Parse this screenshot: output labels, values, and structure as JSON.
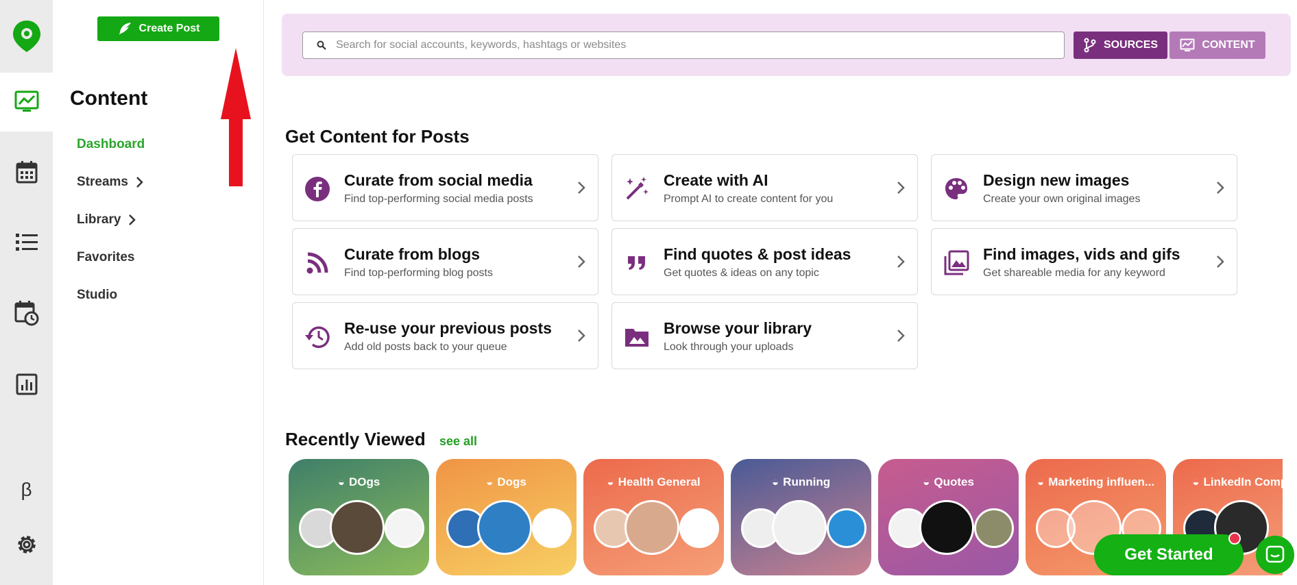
{
  "nav": {
    "create_post": "Create Post",
    "title": "Content",
    "items": [
      {
        "label": "Dashboard",
        "active": true,
        "chevron": false
      },
      {
        "label": "Streams",
        "active": false,
        "chevron": true
      },
      {
        "label": "Library",
        "active": false,
        "chevron": true
      },
      {
        "label": "Favorites",
        "active": false,
        "chevron": false
      },
      {
        "label": "Studio",
        "active": false,
        "chevron": false
      }
    ],
    "beta_label": "β"
  },
  "search": {
    "placeholder": "Search for social accounts, keywords, hashtags or websites",
    "sources_label": "SOURCES",
    "content_label": "CONTENT"
  },
  "sections": {
    "get_content": "Get Content for Posts",
    "recently_viewed": "Recently Viewed",
    "see_all": "see all"
  },
  "cards": [
    {
      "title": "Curate from social media",
      "subtitle": "Find top-performing social media posts",
      "icon": "facebook-icon"
    },
    {
      "title": "Create with AI",
      "subtitle": "Prompt AI to create content for you",
      "icon": "magic-wand-icon"
    },
    {
      "title": "Design new images",
      "subtitle": "Create your own original images",
      "icon": "palette-icon"
    },
    {
      "title": "Curate from blogs",
      "subtitle": "Find top-performing blog posts",
      "icon": "rss-icon"
    },
    {
      "title": "Find quotes & post ideas",
      "subtitle": "Get quotes & ideas on any topic",
      "icon": "quote-icon"
    },
    {
      "title": "Find images, vids and gifs",
      "subtitle": "Get shareable media for any keyword",
      "icon": "images-icon"
    },
    {
      "title": "Re-use your previous posts",
      "subtitle": "Add old posts back to your queue",
      "icon": "history-icon"
    },
    {
      "title": "Browse your library",
      "subtitle": "Look through your uploads",
      "icon": "folder-image-icon"
    }
  ],
  "recent": [
    {
      "label": "DOgs",
      "colors": [
        "#4a8a6a",
        "#8bbb5c"
      ]
    },
    {
      "label": "Dogs",
      "colors": [
        "#f3a04a",
        "#f7c95e"
      ]
    },
    {
      "label": "Health General",
      "colors": [
        "#ef6f4f",
        "#f49a72"
      ]
    },
    {
      "label": "Running",
      "colors": [
        "#4f5b95",
        "#c47f90"
      ]
    },
    {
      "label": "Quotes",
      "colors": [
        "#c75f8f",
        "#9a5aa6"
      ]
    },
    {
      "label": "Marketing influen...",
      "colors": [
        "#ef6d4f",
        "#f59a6b"
      ]
    },
    {
      "label": "LinkedIn Compe",
      "colors": [
        "#ef6d4f",
        "#f5a17a"
      ]
    }
  ],
  "cta": {
    "get_started": "Get Started"
  },
  "colors": {
    "brand_green": "#14a814",
    "purple": "#7a2f7e",
    "purple_light": "#b47ab8",
    "search_panel": "#f3dff3"
  }
}
